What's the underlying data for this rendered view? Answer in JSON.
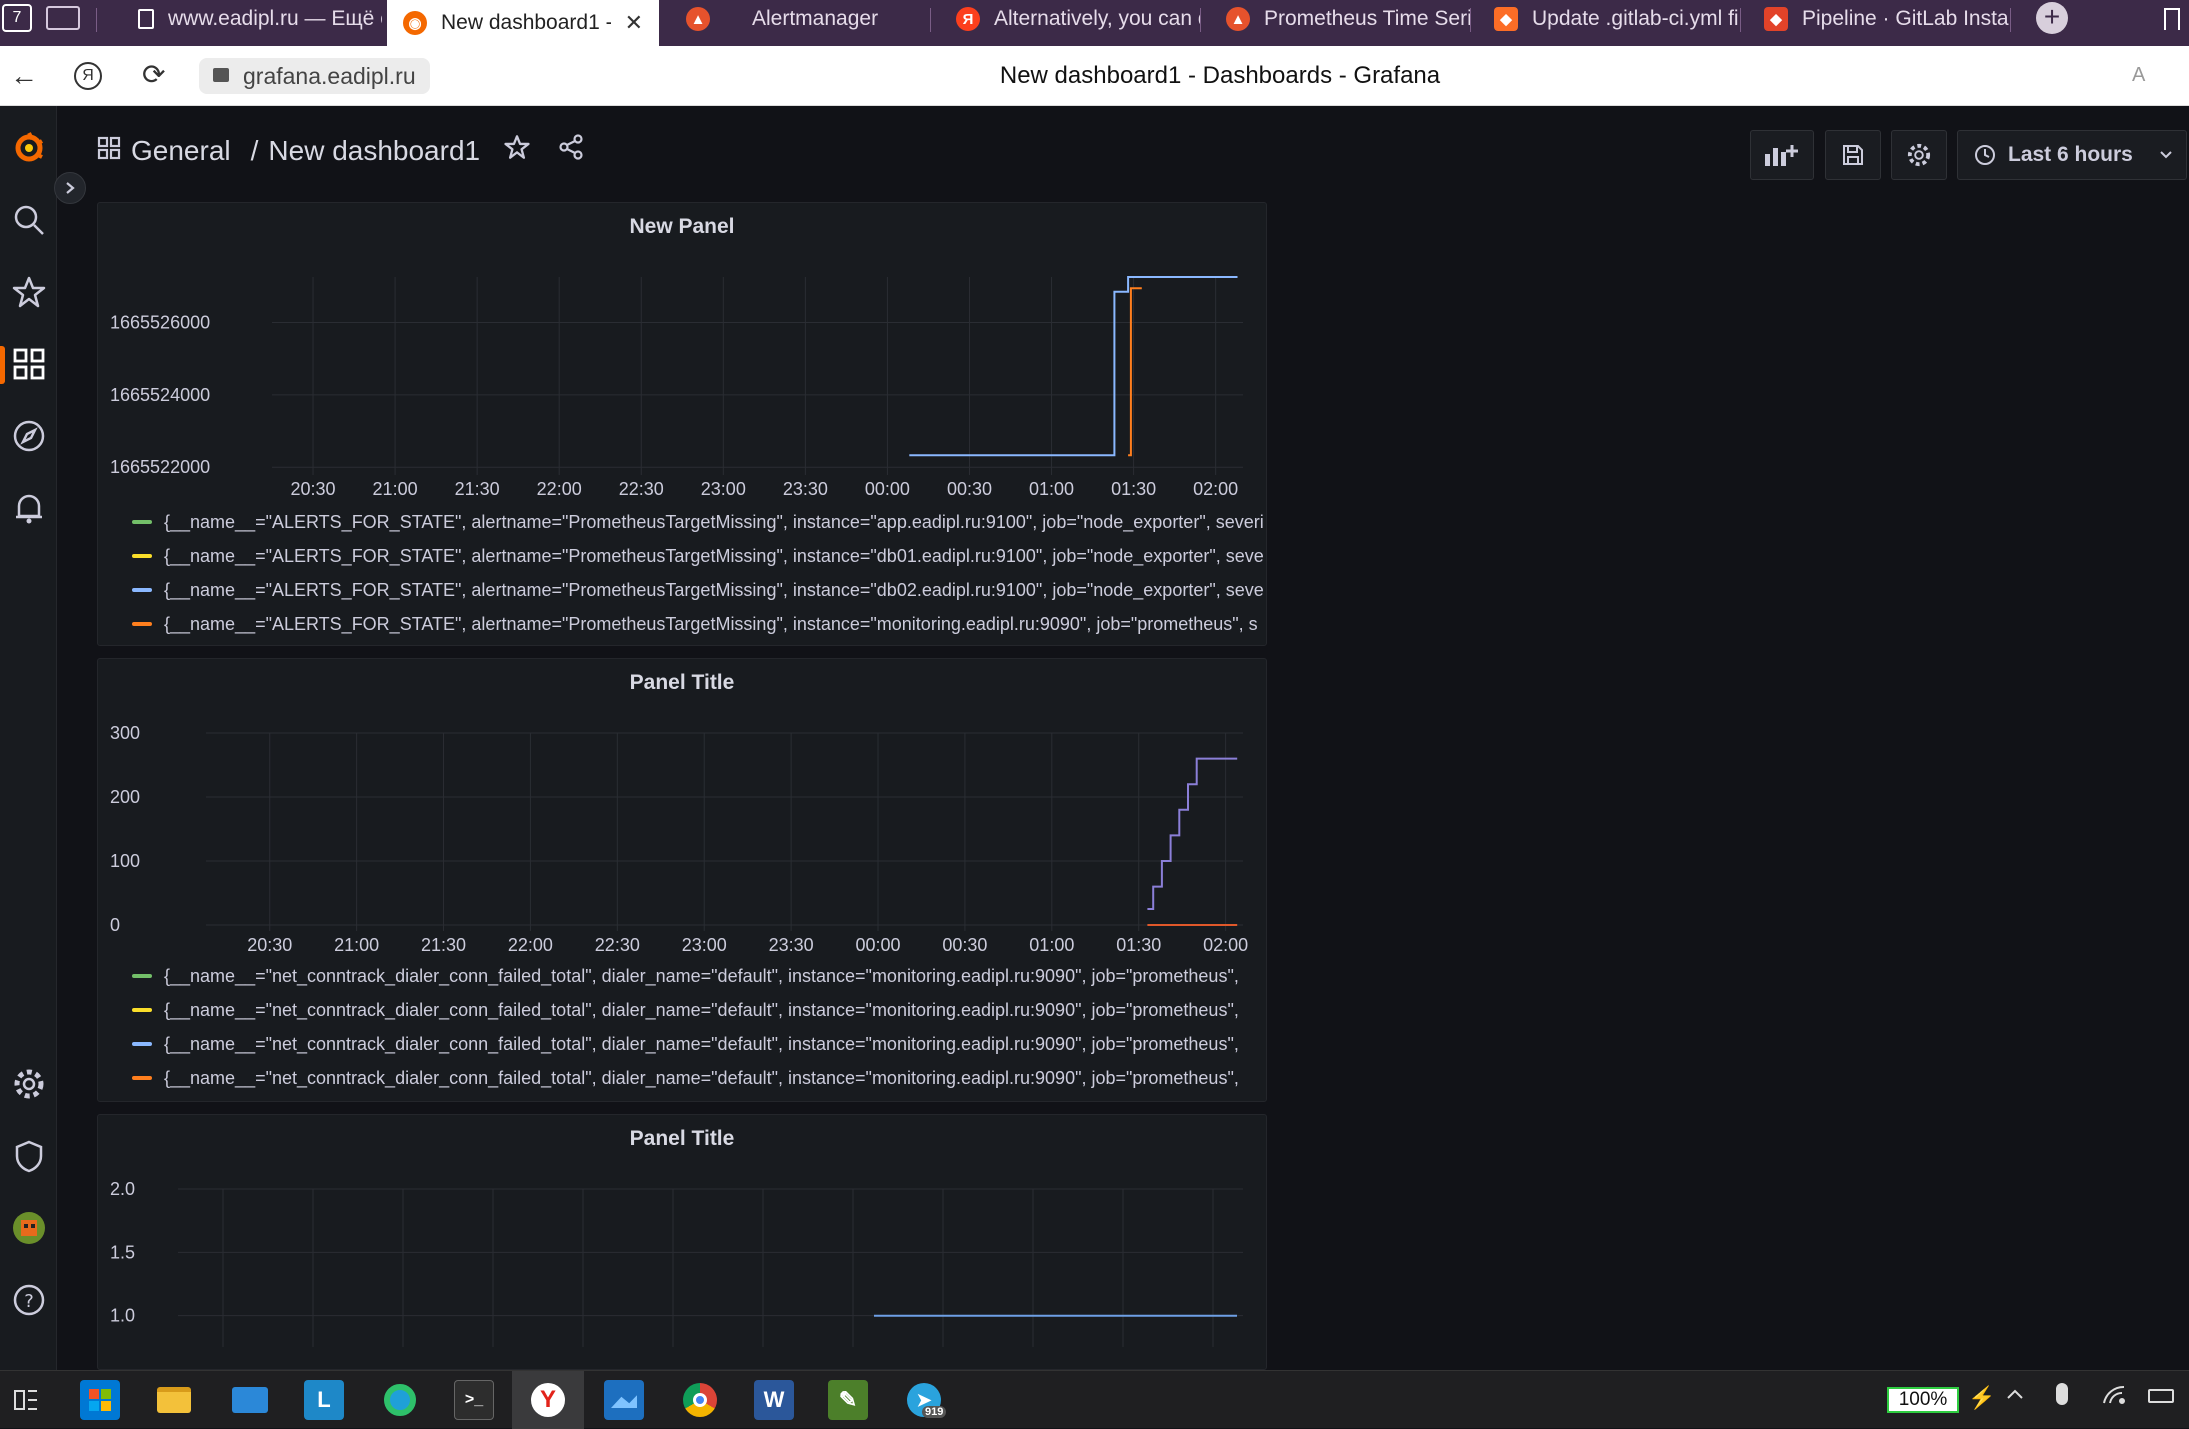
{
  "browser": {
    "tabs": [
      {
        "title": "www.eadipl.ru — Ещё с",
        "icon": "page-icon",
        "active": false
      },
      {
        "title": "New dashboard1 - D",
        "icon": "grafana-icon",
        "active": true
      },
      {
        "title": "Alertmanager",
        "icon": "prometheus-icon",
        "active": false
      },
      {
        "title": "Alternatively, you can d",
        "icon": "yandex-icon",
        "active": false
      },
      {
        "title": "Prometheus Time Serie",
        "icon": "prometheus-icon",
        "active": false
      },
      {
        "title": "Update .gitlab-ci.yml fil",
        "icon": "gitlab-icon",
        "active": false
      },
      {
        "title": "Pipeline · GitLab Instanc",
        "icon": "gitlab-pipeline-icon",
        "active": false
      }
    ],
    "tab_counter": "7",
    "url": "grafana.eadipl.ru",
    "page_title": "New dashboard1 - Dashboards - Grafana"
  },
  "dashboard": {
    "folder": "General",
    "separator": "/",
    "name": "New dashboard1",
    "time_range_label": "Last 6 hours",
    "toolbar_icons": [
      "add-panel-icon",
      "save-icon",
      "settings-icon",
      "clock-icon"
    ]
  },
  "sidebar": {
    "items": [
      "grafana-logo-icon",
      "search-icon",
      "star-icon",
      "dashboards-icon",
      "explore-icon",
      "alerting-icon",
      "settings-icon",
      "shield-icon",
      "avatar",
      "help-icon"
    ],
    "active": "dashboards-icon"
  },
  "panels": [
    {
      "title": "New Panel",
      "legend": [
        {
          "text": "{__name__=\"ALERTS_FOR_STATE\", alertname=\"PrometheusTargetMissing\", instance=\"app.eadipl.ru:9100\", job=\"node_exporter\", severi",
          "color": "#73bf69"
        },
        {
          "text": "{__name__=\"ALERTS_FOR_STATE\", alertname=\"PrometheusTargetMissing\", instance=\"db01.eadipl.ru:9100\", job=\"node_exporter\", seve",
          "color": "#fade2a"
        },
        {
          "text": "{__name__=\"ALERTS_FOR_STATE\", alertname=\"PrometheusTargetMissing\", instance=\"db02.eadipl.ru:9100\", job=\"node_exporter\", seve",
          "color": "#8ab8ff"
        },
        {
          "text": "{__name__=\"ALERTS_FOR_STATE\", alertname=\"PrometheusTargetMissing\", instance=\"monitoring.eadipl.ru:9090\", job=\"prometheus\", s",
          "color": "#ff7f1e"
        }
      ]
    },
    {
      "title": "Panel Title",
      "legend": [
        {
          "text": "{__name__=\"net_conntrack_dialer_conn_failed_total\", dialer_name=\"default\", instance=\"monitoring.eadipl.ru:9090\", job=\"prometheus\",",
          "color": "#73bf69"
        },
        {
          "text": "{__name__=\"net_conntrack_dialer_conn_failed_total\", dialer_name=\"default\", instance=\"monitoring.eadipl.ru:9090\", job=\"prometheus\",",
          "color": "#fade2a"
        },
        {
          "text": "{__name__=\"net_conntrack_dialer_conn_failed_total\", dialer_name=\"default\", instance=\"monitoring.eadipl.ru:9090\", job=\"prometheus\",",
          "color": "#8ab8ff"
        },
        {
          "text": "{__name__=\"net_conntrack_dialer_conn_failed_total\", dialer_name=\"default\", instance=\"monitoring.eadipl.ru:9090\", job=\"prometheus\",",
          "color": "#ff7f1e"
        }
      ]
    },
    {
      "title": "Panel Title",
      "legend": []
    }
  ],
  "chart_data": [
    {
      "type": "line",
      "title": "New Panel",
      "x_ticks": [
        "20:30",
        "21:00",
        "21:30",
        "22:00",
        "22:30",
        "23:00",
        "23:30",
        "00:00",
        "00:30",
        "01:00",
        "01:30",
        "02:00"
      ],
      "y_ticks": [
        1665522000,
        1665524000,
        1665526000
      ],
      "y_tick_labels": [
        "1665522000",
        "1665524000",
        "1665526000"
      ],
      "ylim": [
        1665521950,
        1665527260
      ],
      "xlim": [
        "20:15",
        "02:10"
      ],
      "series": [
        {
          "color": "#8ab8ff",
          "points": [
            [
              "00:08",
              1665522330
            ],
            [
              "01:23",
              1665522330
            ],
            [
              "01:23",
              1665526850
            ],
            [
              "01:28",
              1665526850
            ],
            [
              "01:28",
              1665527260
            ],
            [
              "02:08",
              1665527260
            ]
          ]
        },
        {
          "color": "#ff7f1e",
          "points": [
            [
              "01:28",
              1665522330
            ],
            [
              "01:29",
              1665522330
            ],
            [
              "01:29",
              1665526950
            ],
            [
              "01:33",
              1665526950
            ]
          ]
        }
      ]
    },
    {
      "type": "line",
      "title": "Panel Title",
      "x_ticks": [
        "20:30",
        "21:00",
        "21:30",
        "22:00",
        "22:30",
        "23:00",
        "23:30",
        "00:00",
        "00:30",
        "01:00",
        "01:30",
        "02:00"
      ],
      "y_ticks": [
        0,
        100,
        200,
        300
      ],
      "y_tick_labels": [
        "0",
        "100",
        "200",
        "300"
      ],
      "ylim": [
        0,
        300
      ],
      "xlim": [
        "20:08",
        "02:06"
      ],
      "series": [
        {
          "color": "#8b7fd8",
          "points": [
            [
              "01:33",
              25
            ],
            [
              "01:35",
              25
            ],
            [
              "01:35",
              60
            ],
            [
              "01:38",
              60
            ],
            [
              "01:38",
              100
            ],
            [
              "01:41",
              100
            ],
            [
              "01:41",
              140
            ],
            [
              "01:44",
              140
            ],
            [
              "01:44",
              180
            ],
            [
              "01:47",
              180
            ],
            [
              "01:47",
              220
            ],
            [
              "01:50",
              220
            ],
            [
              "01:50",
              260
            ],
            [
              "02:04",
              260
            ]
          ]
        },
        {
          "color": "#e0582a",
          "points": [
            [
              "01:33",
              0
            ],
            [
              "02:04",
              0
            ]
          ]
        }
      ]
    },
    {
      "type": "line",
      "title": "Panel Title",
      "x_ticks": [],
      "y_ticks": [
        1.0,
        1.5,
        2.0
      ],
      "y_tick_labels": [
        "1.0",
        "1.5",
        "2.0"
      ],
      "ylim": [
        0.8,
        2.0
      ],
      "xlim": [
        "20:15",
        "02:10"
      ],
      "series": [
        {
          "color": "#6ea0e6",
          "points": [
            [
              "00:07",
              1.0
            ],
            [
              "02:08",
              1.0
            ]
          ]
        }
      ]
    }
  ],
  "taskbar": {
    "apps": [
      "task-view-icon",
      "store-icon",
      "explorer-icon",
      "mail-icon",
      "lingvo-icon",
      "edge-icon",
      "terminal-icon",
      "yandex-browser-icon",
      "photos-icon",
      "chrome-icon",
      "word-icon",
      "sheets-icon",
      "telegram-icon"
    ],
    "telegram_badge": "919",
    "battery_label": "100%"
  }
}
